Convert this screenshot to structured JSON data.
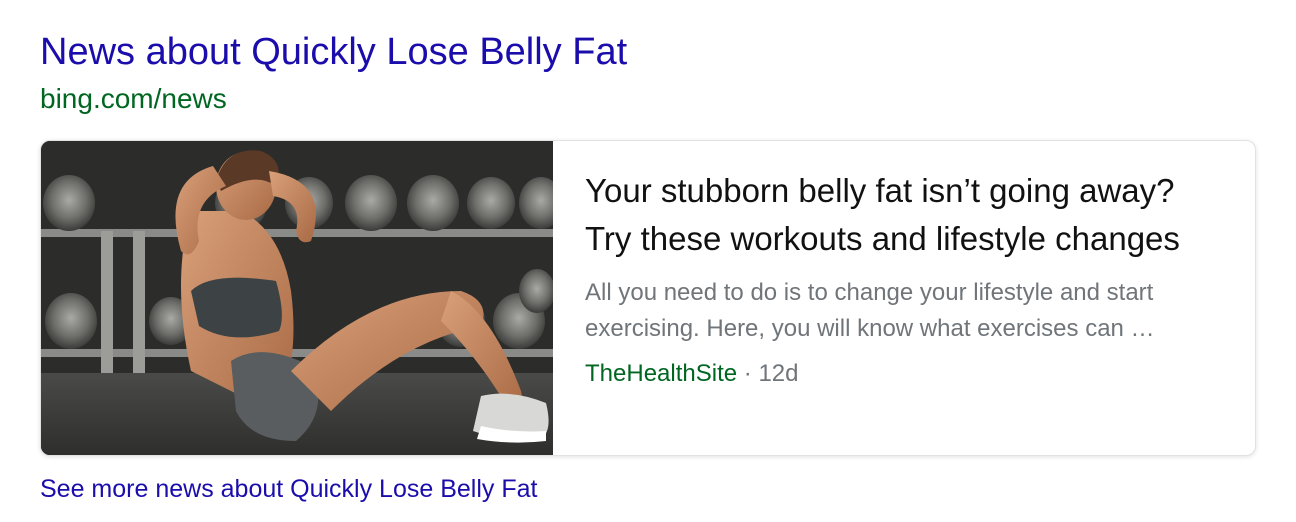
{
  "result": {
    "title": "News about Quickly Lose Belly Fat",
    "source_url": "bing.com/news"
  },
  "card": {
    "headline": "Your stubborn belly fat isn’t going away? Try these workouts and lifestyle changes",
    "snippet": "All you need to do is to change your lifestyle and start exercising. Here, you will know what exercises can …",
    "source": "TheHealthSite",
    "separator": "·",
    "age": "12d",
    "thumbnail_icon": "woman-doing-crunches-gym-photo"
  },
  "see_more": {
    "label": "See more news about Quickly Lose Belly Fat"
  },
  "colors": {
    "link": "#1a0dab",
    "url_green": "#006621",
    "snippet_gray": "#70757a",
    "headline": "#111111"
  }
}
